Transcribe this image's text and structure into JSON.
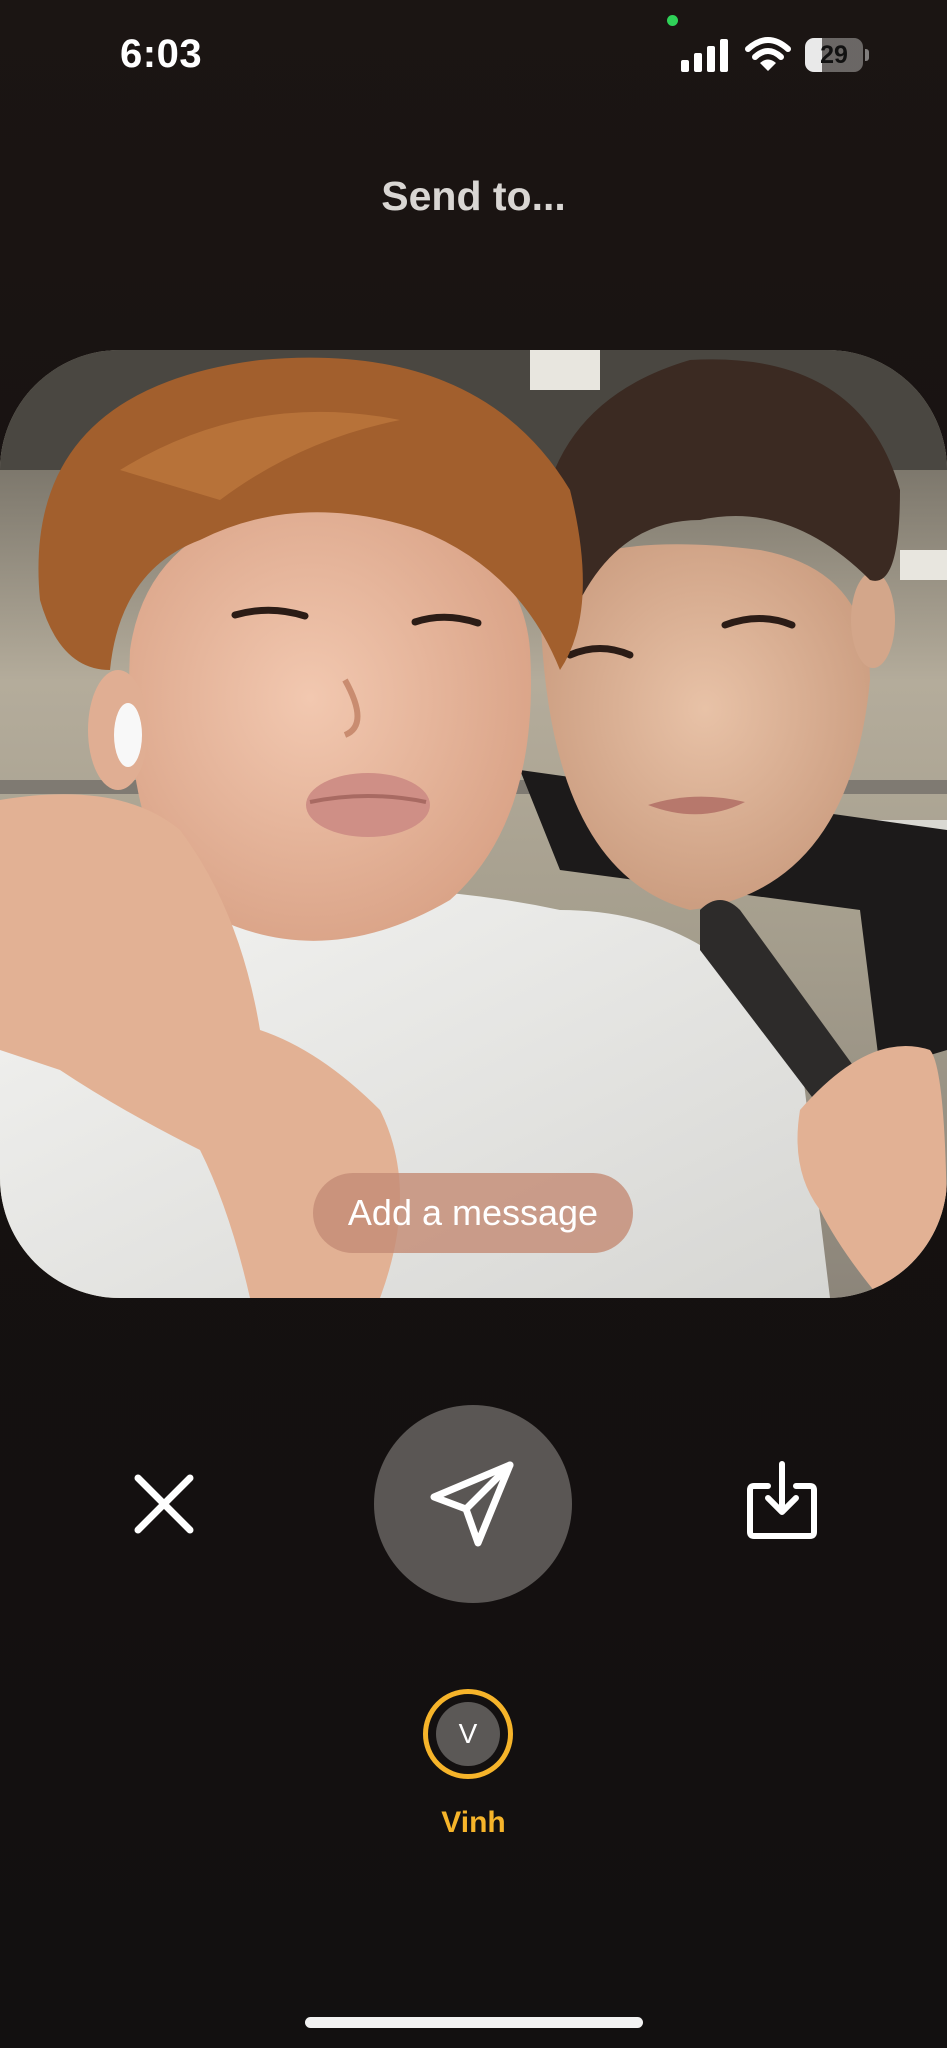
{
  "status_bar": {
    "time": "6:03",
    "battery_level": "29",
    "icons": [
      "signal-icon",
      "wifi-icon",
      "battery-icon"
    ]
  },
  "header": {
    "title": "Send to..."
  },
  "photo": {
    "message_placeholder": "Add a message"
  },
  "actions": {
    "icons": [
      "close-icon",
      "send-icon",
      "download-icon"
    ]
  },
  "recipients": [
    {
      "initial": "V",
      "name": "Vinh"
    }
  ],
  "colors": {
    "background": "#171211",
    "accent": "#f6b42a",
    "send_button": "#5a5654",
    "message_pill": "#c48c76"
  }
}
